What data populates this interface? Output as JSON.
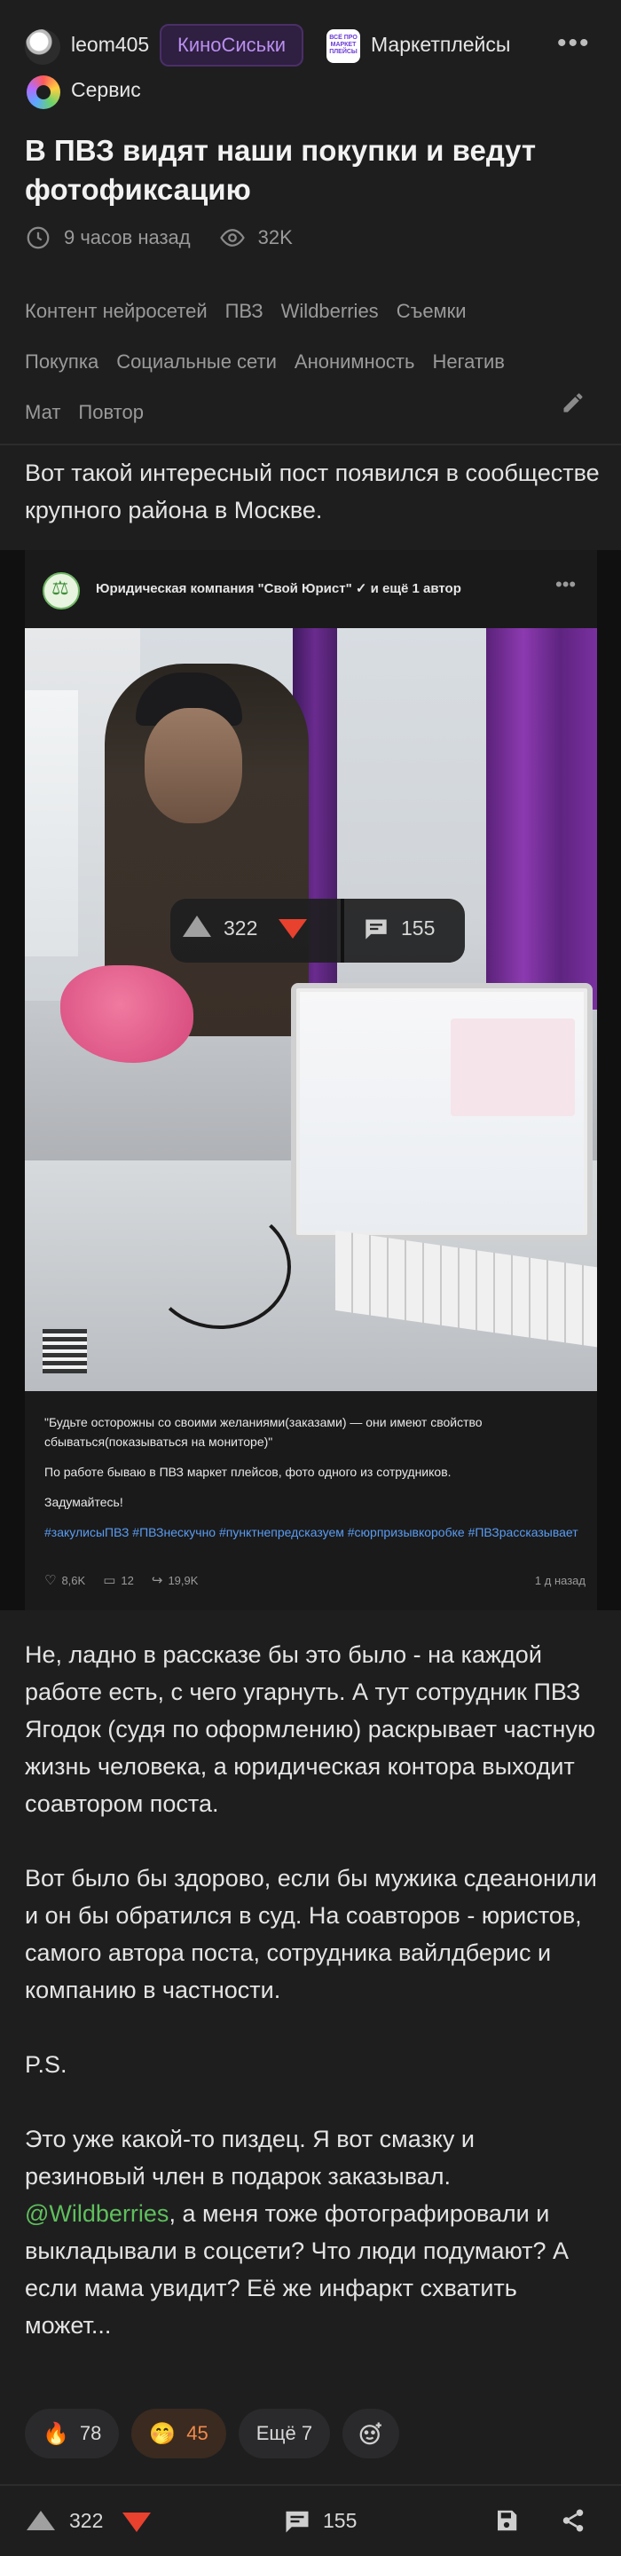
{
  "header": {
    "author": "leom405",
    "badge": "КиноСиськи",
    "community_logo_text": "ВСЁ ПРО МАРКЕТ ПЛЕЙСЫ",
    "community": "Маркетплейсы",
    "service": "Сервис"
  },
  "post": {
    "title": "В ПВЗ видят наши покупки и ведут фотофиксацию",
    "time": "9 часов назад",
    "views": "32K",
    "tags_row1": [
      "Контент нейросетей",
      "ПВЗ",
      "Wildberries",
      "Съемки"
    ],
    "tags_row2": [
      "Покупка",
      "Социальные сети",
      "Анонимность",
      "Негатив"
    ],
    "tags_row3": [
      "Мат",
      "Повтор"
    ],
    "intro": "Вот такой интересный пост появился в сообществе крупного района в Москве.",
    "p1": "Не, ладно в рассказе бы это было - на каждой работе есть, с чего угарнуть. А тут сотрудник ПВЗ Ягодок (судя по оформлению) раскрывает частную жизнь человека, а юридическая контора выходит соавтором поста.",
    "p2": "Вот было бы здорово, если бы мужика сдеанонили и он бы обратился в суд. На соавторов - юристов, самого автора поста, сотрудника вайлдберис и компанию в частности.",
    "p3": "P.S.",
    "p4_before": "Это уже какой-то пиздец. Я вот смазку и резиновый член в подарок заказывал. ",
    "p4_mention": "@Wildberries",
    "p4_after": ", а меня тоже фотографировали и выкладывали в соцсети? Что люди подумают? А если мама увидит? Её же инфаркт схватить может..."
  },
  "embed": {
    "author": "Юридическая компания \"Свой Юрист\" ✓ и ещё 1 автор",
    "caption1": "\"Будьте осторожны со своими желаниями(заказами) — они имеют свойство сбываться(показываться на мониторе)\"",
    "caption2": "По работе бываю в ПВЗ маркет плейсов, фото одного из сотрудников.",
    "caption3": "Задумайтесь!",
    "hashtags": "#закулисыПВЗ #ПВЗнескучно #пунктнепредсказуем #сюрпризывкоробке #ПВЗрассказывает",
    "likes": "8,6K",
    "comments": "12",
    "reposts": "19,9K",
    "date": "1 д назад"
  },
  "overlay": {
    "rating": "322",
    "comments": "155"
  },
  "reactions": [
    {
      "emoji": "🔥",
      "count": "78"
    },
    {
      "emoji": "🤭",
      "count": "45"
    }
  ],
  "reactions_more": "Ещё 7",
  "bottom": {
    "rating": "322",
    "comments": "155"
  },
  "colors": {
    "accent": "#e8412e",
    "mention": "#5fbf5c",
    "badge": "#b98ff0",
    "hashtag": "#5a9cf2"
  }
}
